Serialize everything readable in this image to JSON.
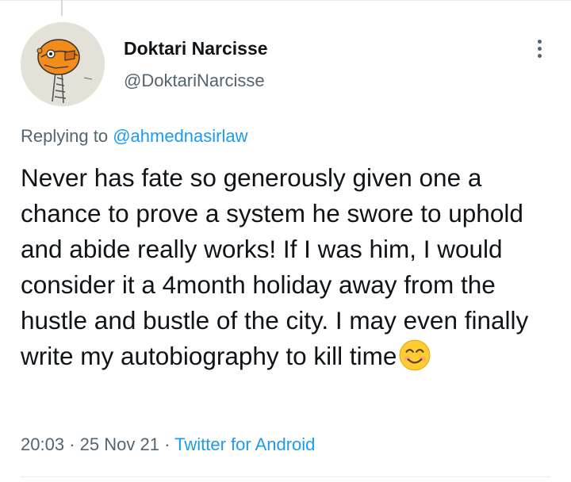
{
  "tweet": {
    "author_name": "Doktari Narcisse",
    "author_handle": "@DoktariNarcisse",
    "replying_prefix": "Replying to",
    "replying_to": "@ahmednasirlaw",
    "text": "Never has fate so generously given one a chance to prove a system he swore to uphold and abide really works! If I was him, I would consider it a 4month holiday away from the hustle and bustle of the city. I may even finally write my autobiography to kill time",
    "emoji": "smiling-face-with-smiling-eyes",
    "time": "20:03",
    "separator_1": "·",
    "date": "25 Nov 21",
    "separator_2": "·",
    "source": "Twitter for Android"
  },
  "colors": {
    "text": "#0f1419",
    "secondary": "#536471",
    "link": "#1d9bf0",
    "divider": "#e6ecf0"
  },
  "icons": {
    "avatar": "orange-helmet-robot-drawing",
    "more": "more-vertical-icon"
  }
}
